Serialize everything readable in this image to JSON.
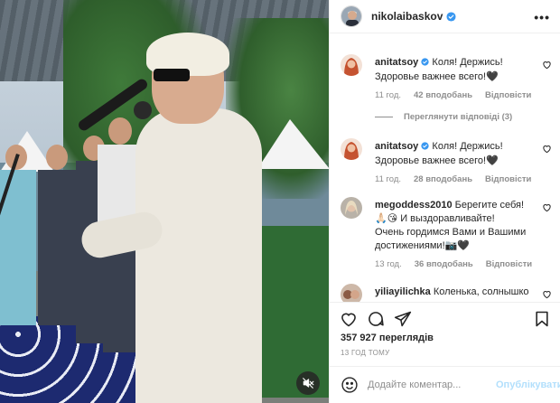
{
  "account": {
    "username": "nikolaibaskov",
    "verified": true
  },
  "comments": [
    {
      "username": "anitatsoy",
      "verified": true,
      "text_lines": [
        "Коля! Держись!",
        "Здоровье важнее всего!🖤"
      ],
      "time": "11 год.",
      "likes": "42 вподобань",
      "reply_label": "Відповісти",
      "view_replies": "Переглянути відповіді (3)"
    },
    {
      "username": "anitatsoy",
      "verified": true,
      "text_lines": [
        "Коля! Держись!",
        "Здоровье важнее всего!🖤"
      ],
      "time": "11 год.",
      "likes": "28 вподобань",
      "reply_label": "Відповісти"
    },
    {
      "username": "megoddess2010",
      "verified": false,
      "text_lines": [
        "Берегите себя!",
        "🙏🏻😘 И выздоравливайте!",
        "Очень гордимся Вами и Вашими",
        "достижениями!📷🖤"
      ],
      "time": "13 год.",
      "likes": "36 вподобань",
      "reply_label": "Відповісти"
    },
    {
      "username": "yiliayilichka",
      "verified": false,
      "text_lines": [
        "Коленька, солнышко"
      ]
    }
  ],
  "stats": {
    "views": "357 927 переглядів",
    "time_ago": "13 ГОД ТОМУ"
  },
  "composer": {
    "placeholder": "Додайте коментар...",
    "post_label": "Опублікувати"
  },
  "colors": {
    "verified_badge": "#3897f0",
    "post_button_disabled": "#b2dffc",
    "secondary_text": "#8e8e8e",
    "divider": "#efefef"
  },
  "icons": {
    "more": "more-options-icon",
    "like": "heart-icon",
    "comment": "comment-icon",
    "share": "share-icon",
    "save": "bookmark-icon",
    "emoji": "emoji-icon",
    "mute": "muted-speaker-icon",
    "verified": "verified-badge-icon"
  }
}
